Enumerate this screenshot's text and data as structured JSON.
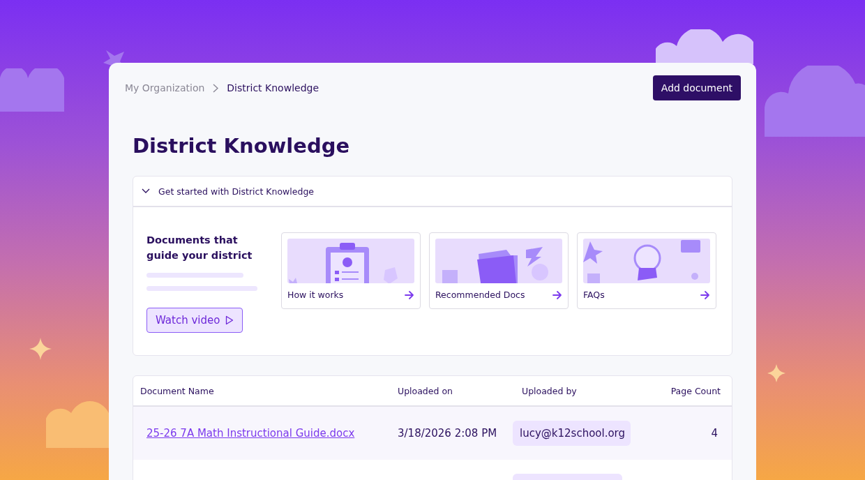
{
  "breadcrumb": {
    "items": [
      "My Organization",
      "District Knowledge"
    ]
  },
  "add_button": "Add document",
  "title": "District Knowledge",
  "get_started": {
    "title": "Get started with District Knowledge",
    "expanded": true,
    "intro": "Documents that guide your district",
    "watch_button": "Watch video",
    "cards": [
      {
        "label": "How it works"
      },
      {
        "label": "Recommended Docs"
      },
      {
        "label": "FAQs"
      }
    ]
  },
  "table": {
    "columns": [
      "Document Name",
      "Uploaded on",
      "Uploaded by",
      "Page Count"
    ],
    "rows": [
      {
        "name": "25-26 7A Math Instructional Guide.docx",
        "uploaded_on": "3/18/2026 2:08 PM",
        "uploaded_by": "lucy@k12school.org",
        "page_count": "4"
      }
    ]
  }
}
